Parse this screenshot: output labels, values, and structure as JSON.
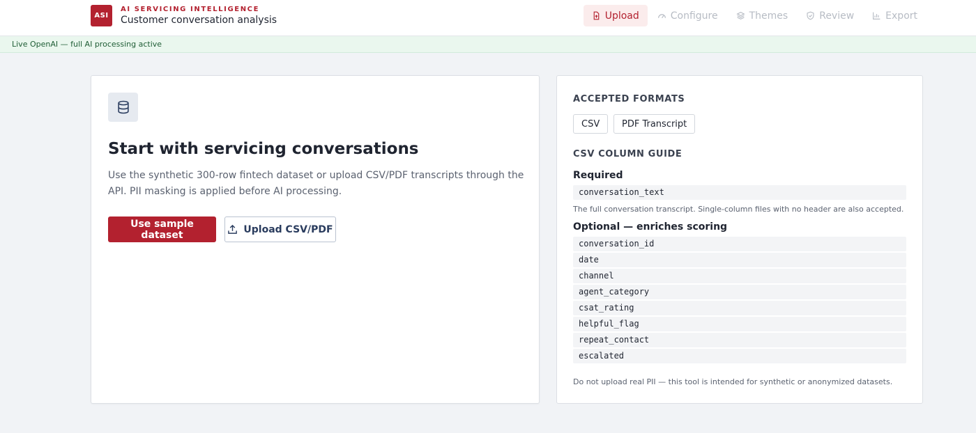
{
  "header": {
    "logo_text": "ASI",
    "eyebrow": "AI SERVICING INTELLIGENCE",
    "title": "Customer conversation analysis",
    "nav": [
      {
        "label": "Upload",
        "icon": "file-upload-icon",
        "active": true
      },
      {
        "label": "Configure",
        "icon": "gauge-icon",
        "active": false
      },
      {
        "label": "Themes",
        "icon": "layers-icon",
        "active": false
      },
      {
        "label": "Review",
        "icon": "shield-check-icon",
        "active": false
      },
      {
        "label": "Export",
        "icon": "bar-chart-icon",
        "active": false
      }
    ]
  },
  "status": {
    "text": "Live OpenAI — full AI processing active"
  },
  "start": {
    "icon": "database-icon",
    "title": "Start with servicing conversations",
    "description": "Use the synthetic 300-row fintech dataset or upload CSV/PDF transcripts through the API. PII masking is applied before AI processing.",
    "sample_button": "Use sample dataset",
    "upload_button": "Upload CSV/PDF",
    "upload_icon": "upload-icon"
  },
  "formats": {
    "heading": "ACCEPTED FORMATS",
    "items": [
      "CSV",
      "PDF Transcript"
    ]
  },
  "guide": {
    "heading": "CSV COLUMN GUIDE",
    "required_label": "Required",
    "required_column": "conversation_text",
    "required_note": "The full conversation transcript. Single-column files with no header are also accepted.",
    "optional_label": "Optional — enriches scoring",
    "optional_columns": [
      "conversation_id",
      "date",
      "channel",
      "agent_category",
      "csat_rating",
      "helpful_flag",
      "repeat_contact",
      "escalated"
    ],
    "disclaimer": "Do not upload real PII — this tool is intended for synthetic or anonymized datasets."
  },
  "colors": {
    "brand": "#b3212f",
    "status_bg": "#eaf7ee",
    "page_bg": "#f1f3f6"
  }
}
